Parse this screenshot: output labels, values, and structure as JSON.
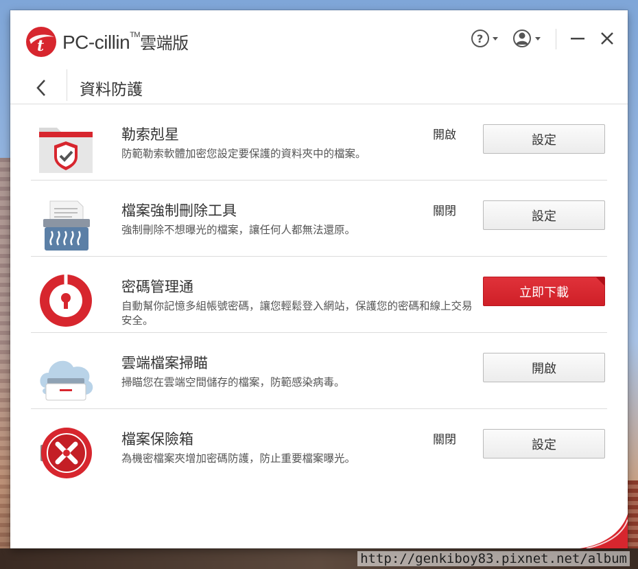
{
  "app": {
    "brand_name": "PC-cillin",
    "trademark": "TM",
    "edition": "雲端版",
    "accent_color": "#d7262e"
  },
  "header": {
    "help_icon": "help-circle-icon",
    "account_icon": "user-circle-icon",
    "minimize_icon": "minimize-icon",
    "close_icon": "close-icon"
  },
  "subheader": {
    "back_icon": "chevron-left-icon",
    "title": "資料防護"
  },
  "features": [
    {
      "icon": "folder-shield-icon",
      "title": "勒索剋星",
      "description": "防範勒索軟體加密您設定要保護的資料夾中的檔案。",
      "status": "開啟",
      "button": "設定",
      "button_style": "default"
    },
    {
      "icon": "shredder-icon",
      "title": "檔案強制刪除工具",
      "description": "強制刪除不想曝光的檔案，讓任何人都無法還原。",
      "status": "關閉",
      "button": "設定",
      "button_style": "default"
    },
    {
      "icon": "password-manager-icon",
      "title": "密碼管理通",
      "description": "自動幫你記憶多組帳號密碼，讓您輕鬆登入網站，保護您的密碼和線上交易安全。",
      "status": "",
      "button": "立即下載",
      "button_style": "primary"
    },
    {
      "icon": "cloud-drawer-icon",
      "title": "雲端檔案掃瞄",
      "description": "掃瞄您在雲端空間儲存的檔案，防範感染病毒。",
      "status": "",
      "button": "開啟",
      "button_style": "default"
    },
    {
      "icon": "vault-icon",
      "title": "檔案保險箱",
      "description": "為機密檔案夾增加密碼防護，防止重要檔案曝光。",
      "status": "關閉",
      "button": "設定",
      "button_style": "default"
    }
  ],
  "watermark": "http://genkiboy83.pixnet.net/album"
}
